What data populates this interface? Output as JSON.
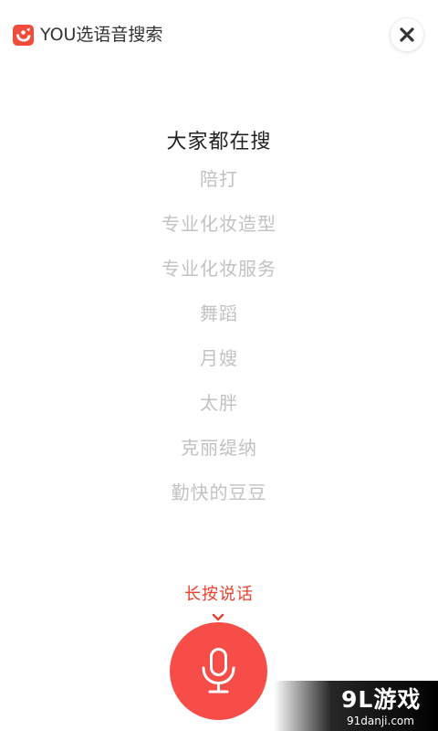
{
  "header": {
    "app_title": "YOU选语音搜索",
    "logo_icon": "whale-logo-icon",
    "close_icon": "close-icon"
  },
  "hot_searches": {
    "title": "大家都在搜",
    "items": [
      "陪打",
      "专业化妆造型",
      "专业化妆服务",
      "舞蹈",
      "月嫂",
      "太胖",
      "克丽缇纳",
      "勤快的豆豆"
    ]
  },
  "voice": {
    "hint": "长按说话",
    "mic_icon": "microphone-icon"
  },
  "watermark": {
    "logo": "9L游戏",
    "url": "91danji.com"
  },
  "colors": {
    "accent": "#f64d48",
    "hint_text": "#e8412f",
    "item_text": "#c2c2c2",
    "title_text": "#222222"
  }
}
